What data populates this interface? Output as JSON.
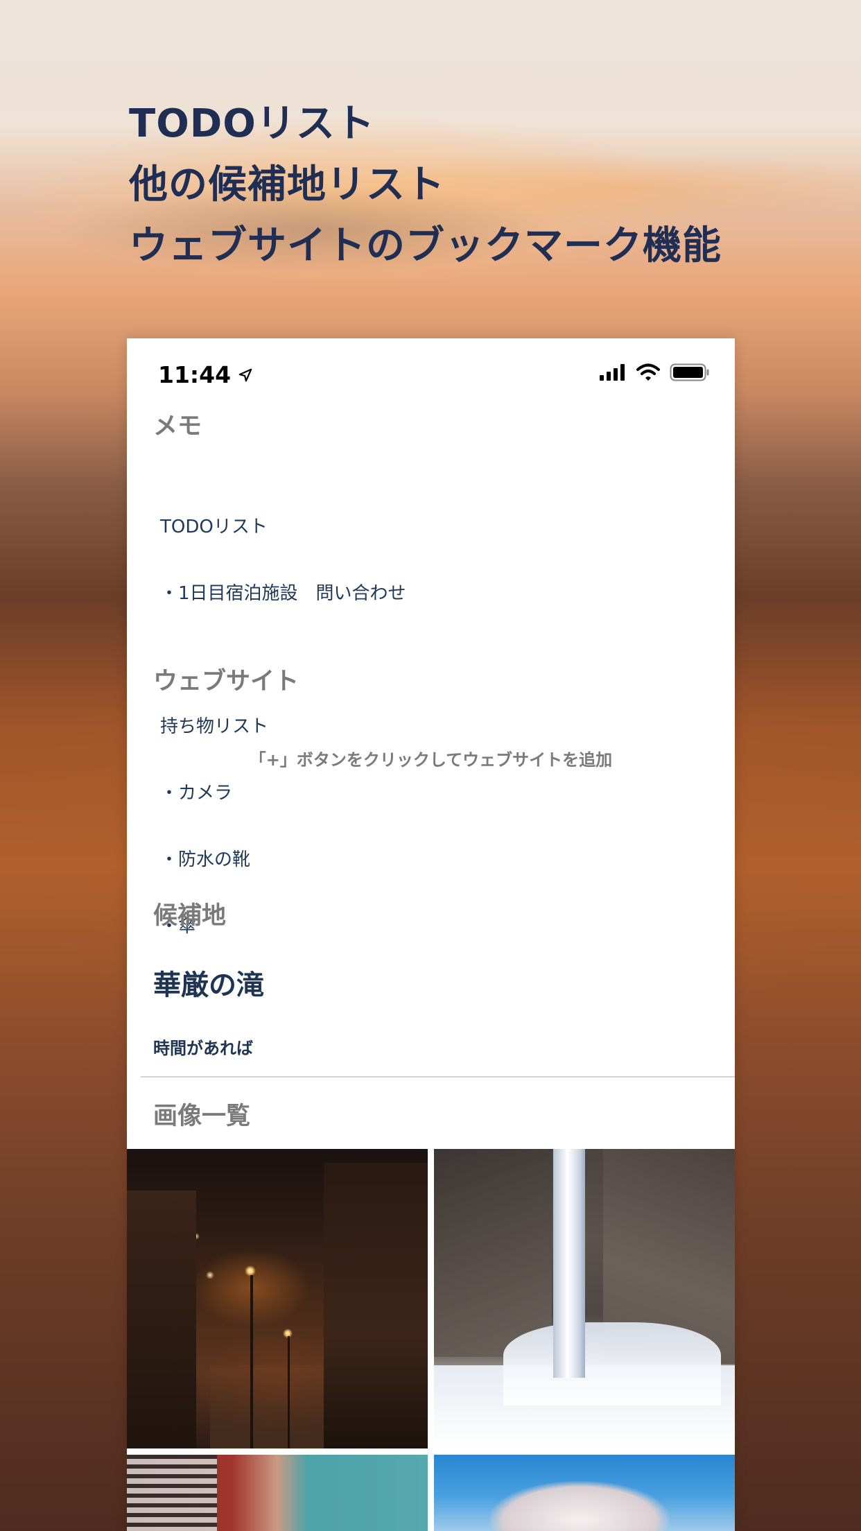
{
  "headline": {
    "line1": "TODOリスト",
    "line2": "他の候補地リスト",
    "line3": "ウェブサイトのブックマーク機能"
  },
  "status_bar": {
    "time": "11:44",
    "icons": [
      "location-arrow-icon",
      "cellular-signal-icon",
      "wifi-icon",
      "battery-icon"
    ]
  },
  "memo": {
    "title": "メモ",
    "lines": [
      "TODOリスト",
      "・1日目宿泊施設　問い合わせ",
      "",
      "持ち物リスト",
      "・カメラ",
      "・防水の靴",
      "・傘"
    ]
  },
  "website": {
    "title": "ウェブサイト",
    "empty_hint": "「+」ボタンをクリックしてウェブサイトを追加"
  },
  "candidate": {
    "title": "候補地",
    "name": "華厳の滝",
    "note": "時間があれば"
  },
  "gallery": {
    "title": "画像一覧",
    "images": [
      "old-town-night-photo",
      "frozen-waterfall-photo",
      "railway-bridge-photo",
      "blossom-tree-photo"
    ]
  },
  "colors": {
    "headline": "#1f2e52",
    "label_gray": "#7a7a7a",
    "body_navy": "#1f3858"
  }
}
